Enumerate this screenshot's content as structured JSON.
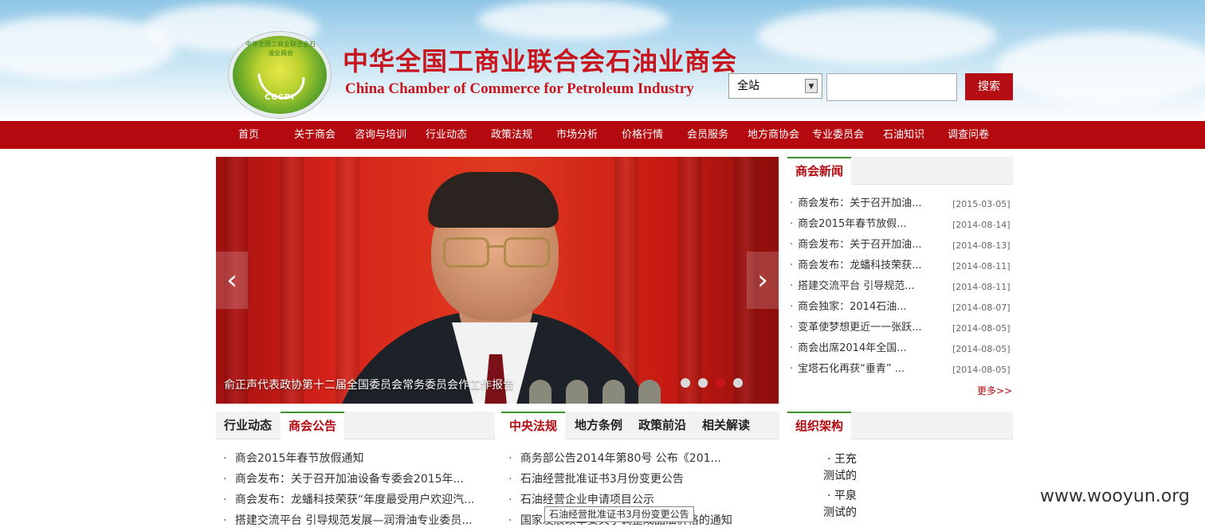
{
  "header": {
    "title_cn": "中华全国工商业联合会石油业商会",
    "title_en": "China Chamber of Commerce for Petroleum Industry",
    "logo_ring_text": "中华全国工商业联合会石油业商会",
    "logo_acronym": "CCCPI"
  },
  "search": {
    "scope_value": "全站",
    "placeholder": "",
    "button_label": "搜索"
  },
  "nav": {
    "items": [
      "首页",
      "关于商会",
      "咨询与培训",
      "行业动态",
      "政策法规",
      "市场分析",
      "价格行情",
      "会员服务",
      "地方商协会",
      "专业委员会",
      "石油知识",
      "调查问卷"
    ]
  },
  "slider": {
    "caption": "俞正声代表政协第十二届全国委员会常务委员会作工作报告",
    "prev_glyph": "‹",
    "next_glyph": "›",
    "active_dot": 3,
    "dot_count": 4
  },
  "chamber_news": {
    "title": "商会新闻",
    "items": [
      {
        "title": "商会发布：关于召开加油...",
        "date": "[2015-03-05]"
      },
      {
        "title": "商会2015年春节放假...",
        "date": "[2014-08-14]"
      },
      {
        "title": "商会发布：关于召开加油...",
        "date": "[2014-08-13]"
      },
      {
        "title": "商会发布：龙蟠科技荣获...",
        "date": "[2014-08-11]"
      },
      {
        "title": "搭建交流平台 引导规范...",
        "date": "[2014-08-11]"
      },
      {
        "title": "商会独家：2014石油...",
        "date": "[2014-08-07]"
      },
      {
        "title": "变革使梦想更近一一张跃...",
        "date": "[2014-08-05]"
      },
      {
        "title": "商会出席2014年全国...",
        "date": "[2014-08-05]"
      },
      {
        "title": "宝塔石化再获“垂青” ...",
        "date": "[2014-08-05]"
      }
    ],
    "more_label": "更多>>"
  },
  "announcements": {
    "tabs": [
      "行业动态",
      "商会公告"
    ],
    "active_tab": 1,
    "items": [
      "商会2015年春节放假通知",
      "商会发布：关于召开加油设备专委会2015年...",
      "商会发布：龙蟠科技荣获“年度最受用户欢迎汽...",
      "搭建交流平台 引导规范发展—润滑油专业委员..."
    ]
  },
  "regulations": {
    "tabs": [
      "中央法规",
      "地方条例",
      "政策前沿",
      "相关解读"
    ],
    "active_tab": 0,
    "items": [
      "商务部公告2014年第80号 公布《201...",
      "石油经营批准证书3月份变更公告",
      "石油经营企业申请项目公示",
      "国家发展改革委关于调整成品油价格的通知"
    ],
    "tooltip": "石油经营批准证书3月份变更公告"
  },
  "organization": {
    "title": "组织架构",
    "items": [
      {
        "name": "· 王充",
        "note": "测试的"
      },
      {
        "name": "· 平泉",
        "note": "测试的"
      }
    ]
  },
  "watermark": "www.wooyun.org",
  "colors": {
    "brand_red": "#b3090f",
    "tab_green": "#3f8f2d",
    "active_dot": "#c8141c"
  }
}
